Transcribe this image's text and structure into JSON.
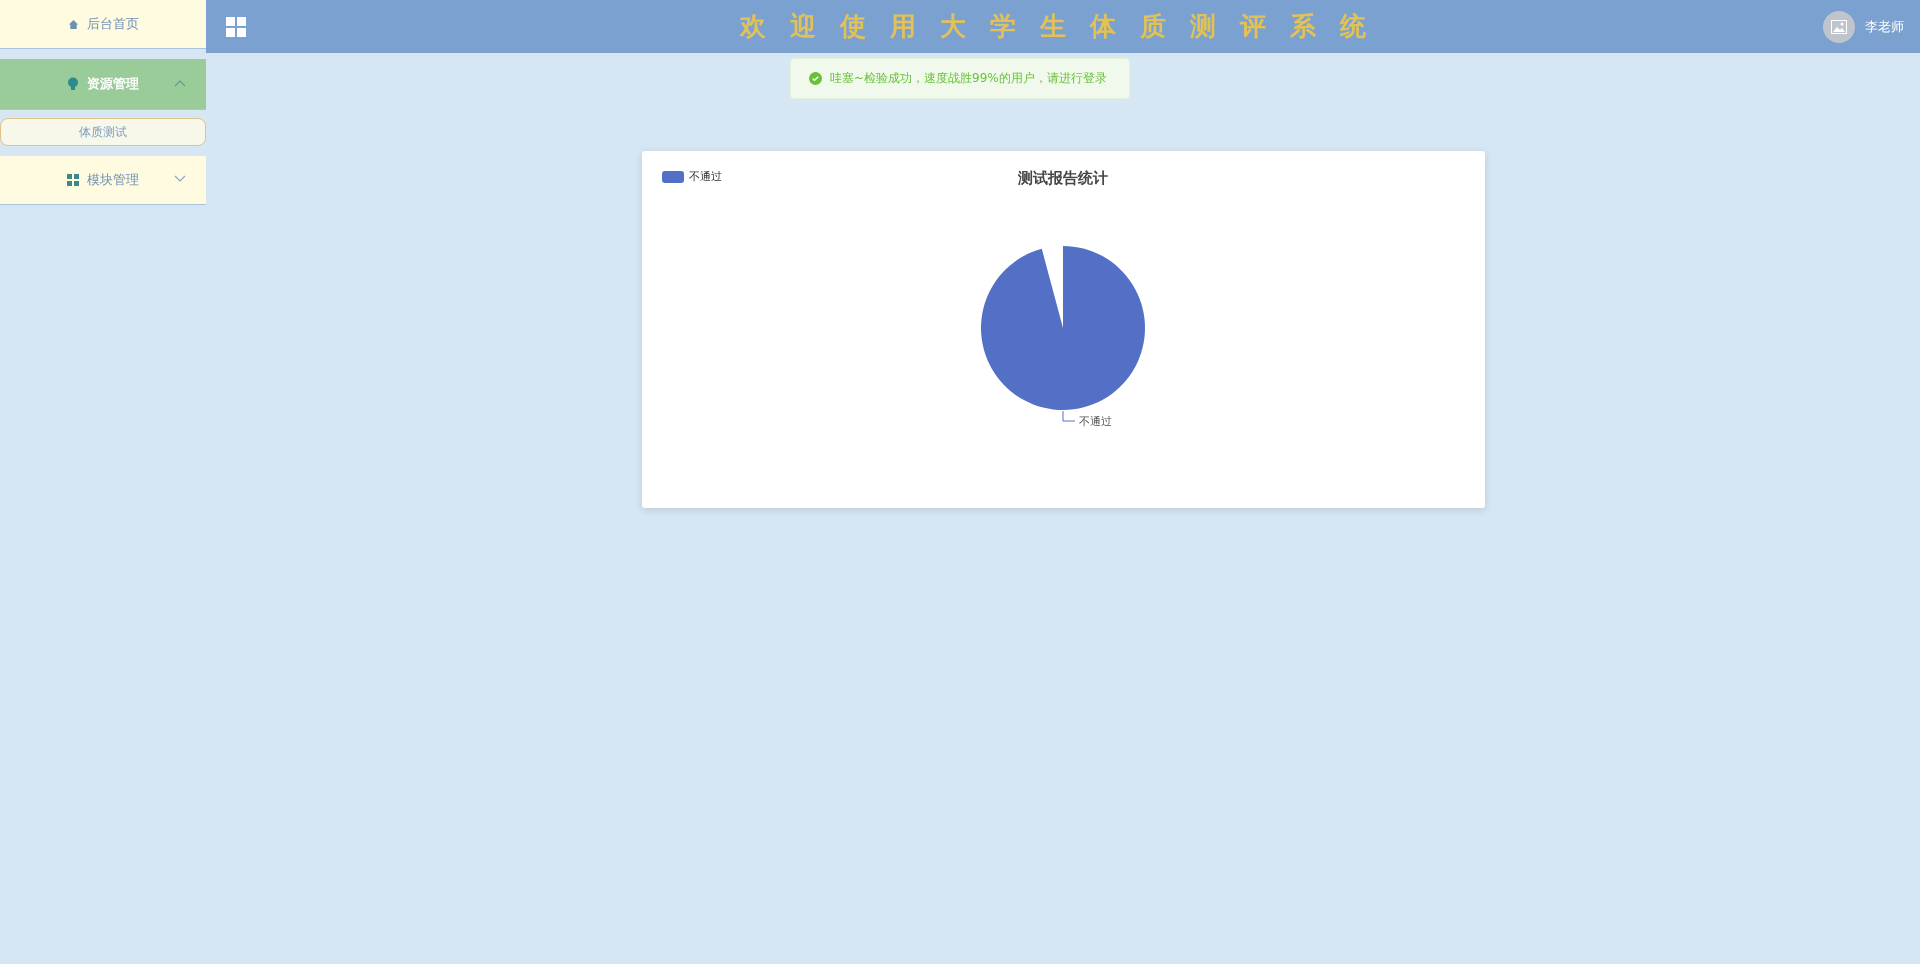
{
  "sidebar": {
    "items": [
      {
        "label": "后台首页",
        "selected": false
      },
      {
        "label": "资源管理",
        "selected": true,
        "expanded": true,
        "children": [
          {
            "label": "体质测试"
          }
        ]
      },
      {
        "label": "模块管理",
        "selected": false,
        "expanded": false
      }
    ]
  },
  "header": {
    "title": "欢迎使用大学生体质测评系统",
    "user": "李老师"
  },
  "toast": {
    "kind": "success",
    "message": "哇塞~检验成功，速度战胜99%的用户，请进行登录"
  },
  "chart": {
    "title": "测试报告统计",
    "legend": [
      {
        "label": "不通过",
        "color": "#5470c6"
      }
    ],
    "slice_labels": [
      "不通过"
    ]
  }
}
